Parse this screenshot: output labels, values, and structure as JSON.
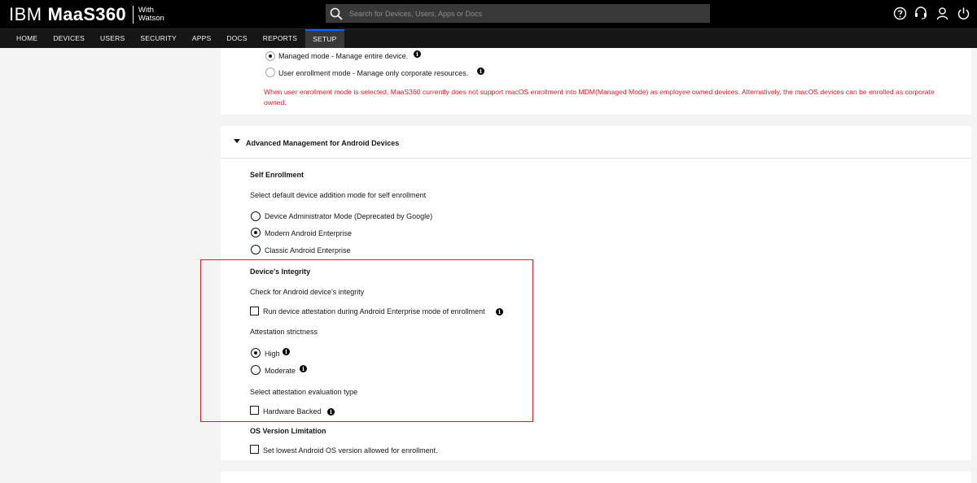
{
  "header": {
    "brand_ibm": "IBM",
    "brand_product": "MaaS360",
    "brand_with_line1": "With",
    "brand_with_line2": "Watson",
    "search_placeholder": "Search for Devices, Users, Apps or Docs",
    "icons": [
      "help-icon",
      "support-icon",
      "user-icon",
      "power-icon"
    ]
  },
  "nav": {
    "items": [
      "HOME",
      "DEVICES",
      "USERS",
      "SECURITY",
      "APPS",
      "DOCS",
      "REPORTS",
      "SETUP"
    ],
    "active": "SETUP",
    "accent_color": "#0f62fe"
  },
  "macos": {
    "managed_label": "Managed mode - Manage entire device.",
    "user_enroll_label": "User enrollment mode - Manage only corporate resources.",
    "selected": "Managed mode",
    "warning": "When user enrollment mode is selected, MaaS360 currently does not support macOS enrollment into MDM(Managed Mode) as employee owned devices. Alternatively, the macOS devices can be enrolled as corporate owned.",
    "warning_color": "#da1e28"
  },
  "android": {
    "section_title": "Advanced Management for Android Devices",
    "self_enrollment": {
      "title": "Self Enrollment",
      "description": "Select default device addition mode for self enrollment",
      "options": [
        "Device Administrator Mode (Deprecated by Google)",
        "Modern Android Enterprise",
        "Classic Android Enterprise"
      ],
      "selected": "Modern Android Enterprise"
    },
    "integrity": {
      "title": "Device's Integrity",
      "check_label": "Check for Android device's integrity",
      "attestation_checkbox": "Run device attestation during Android Enterprise mode of enrollment",
      "attestation_checked": false,
      "strictness_label": "Attestation strictness",
      "strictness_options": [
        "High",
        "Moderate"
      ],
      "strictness_selected": "High",
      "evaluation_label": "Select attestation evaluation type",
      "hardware_backed": "Hardware Backed",
      "hardware_backed_checked": false,
      "highlight_color": "#da1e28"
    },
    "os_version": {
      "title": "OS Version Limitation",
      "checkbox": "Set lowest Android OS version allowed for enrollment.",
      "checked": false
    }
  }
}
